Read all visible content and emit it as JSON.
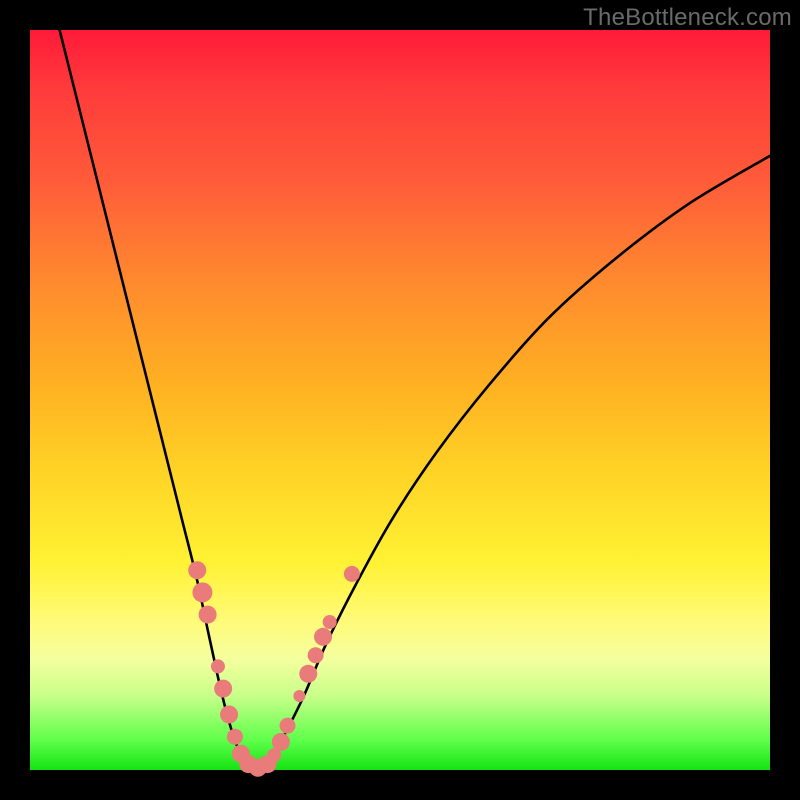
{
  "watermark": "TheBottleneck.com",
  "colors": {
    "frame": "#000000",
    "curve": "#000000",
    "dot_fill": "#e97b7b",
    "dot_stroke": "#d36a6a",
    "gradient_stops": [
      {
        "pos": 0.0,
        "hex": "#ff1a3a"
      },
      {
        "pos": 0.08,
        "hex": "#ff3b3b"
      },
      {
        "pos": 0.2,
        "hex": "#ff5a3a"
      },
      {
        "pos": 0.34,
        "hex": "#ff8a2e"
      },
      {
        "pos": 0.48,
        "hex": "#ffb122"
      },
      {
        "pos": 0.6,
        "hex": "#ffd426"
      },
      {
        "pos": 0.72,
        "hex": "#fff234"
      },
      {
        "pos": 0.8,
        "hex": "#fffb7a"
      },
      {
        "pos": 0.85,
        "hex": "#f4ff9e"
      },
      {
        "pos": 0.9,
        "hex": "#c8ff8a"
      },
      {
        "pos": 0.96,
        "hex": "#5eff4a"
      },
      {
        "pos": 1.0,
        "hex": "#15e312"
      }
    ]
  },
  "chart_data": {
    "type": "line",
    "title": "",
    "xlabel": "",
    "ylabel": "",
    "xlim": [
      0,
      100
    ],
    "ylim": [
      0,
      100
    ],
    "note": "Plot area is 740×740 px inside a 30 px black border. Curve values are approximate readings from the image: y_pct is height above the bottom edge of the gradient plot area, x_pct is distance from the left edge.",
    "series": [
      {
        "name": "bottleneck-curve-left",
        "branch": "left",
        "points": [
          {
            "x_pct": 4.0,
            "y_pct": 100.0
          },
          {
            "x_pct": 6.0,
            "y_pct": 92.0
          },
          {
            "x_pct": 8.5,
            "y_pct": 82.0
          },
          {
            "x_pct": 11.0,
            "y_pct": 72.0
          },
          {
            "x_pct": 13.5,
            "y_pct": 62.0
          },
          {
            "x_pct": 16.0,
            "y_pct": 52.0
          },
          {
            "x_pct": 18.5,
            "y_pct": 42.0
          },
          {
            "x_pct": 20.5,
            "y_pct": 34.0
          },
          {
            "x_pct": 22.5,
            "y_pct": 26.0
          },
          {
            "x_pct": 24.0,
            "y_pct": 19.0
          },
          {
            "x_pct": 25.3,
            "y_pct": 13.0
          },
          {
            "x_pct": 26.5,
            "y_pct": 8.0
          },
          {
            "x_pct": 27.7,
            "y_pct": 4.0
          },
          {
            "x_pct": 29.0,
            "y_pct": 1.2
          },
          {
            "x_pct": 30.5,
            "y_pct": 0.0
          }
        ]
      },
      {
        "name": "bottleneck-curve-right",
        "branch": "right",
        "points": [
          {
            "x_pct": 30.5,
            "y_pct": 0.0
          },
          {
            "x_pct": 32.5,
            "y_pct": 1.5
          },
          {
            "x_pct": 34.5,
            "y_pct": 5.0
          },
          {
            "x_pct": 37.0,
            "y_pct": 10.0
          },
          {
            "x_pct": 40.0,
            "y_pct": 17.0
          },
          {
            "x_pct": 44.0,
            "y_pct": 25.0
          },
          {
            "x_pct": 49.0,
            "y_pct": 34.0
          },
          {
            "x_pct": 55.0,
            "y_pct": 43.0
          },
          {
            "x_pct": 62.0,
            "y_pct": 52.0
          },
          {
            "x_pct": 70.0,
            "y_pct": 61.0
          },
          {
            "x_pct": 79.0,
            "y_pct": 69.0
          },
          {
            "x_pct": 89.0,
            "y_pct": 76.5
          },
          {
            "x_pct": 100.0,
            "y_pct": 83.0
          }
        ]
      }
    ],
    "dots": {
      "name": "highlight-dots",
      "note": "Salmon-colored circular markers near the valley. r is radius in px.",
      "points": [
        {
          "x_pct": 22.6,
          "y_pct": 27.0,
          "r": 9
        },
        {
          "x_pct": 23.3,
          "y_pct": 24.0,
          "r": 10
        },
        {
          "x_pct": 24.0,
          "y_pct": 21.0,
          "r": 9
        },
        {
          "x_pct": 25.4,
          "y_pct": 14.0,
          "r": 7
        },
        {
          "x_pct": 26.1,
          "y_pct": 11.0,
          "r": 9
        },
        {
          "x_pct": 26.9,
          "y_pct": 7.5,
          "r": 9
        },
        {
          "x_pct": 27.7,
          "y_pct": 4.5,
          "r": 8
        },
        {
          "x_pct": 28.5,
          "y_pct": 2.2,
          "r": 9
        },
        {
          "x_pct": 29.5,
          "y_pct": 0.8,
          "r": 9
        },
        {
          "x_pct": 30.8,
          "y_pct": 0.3,
          "r": 9
        },
        {
          "x_pct": 32.1,
          "y_pct": 0.8,
          "r": 9
        },
        {
          "x_pct": 33.0,
          "y_pct": 2.0,
          "r": 7
        },
        {
          "x_pct": 33.9,
          "y_pct": 3.8,
          "r": 9
        },
        {
          "x_pct": 34.8,
          "y_pct": 6.0,
          "r": 8
        },
        {
          "x_pct": 36.4,
          "y_pct": 10.0,
          "r": 6
        },
        {
          "x_pct": 37.6,
          "y_pct": 13.0,
          "r": 9
        },
        {
          "x_pct": 38.6,
          "y_pct": 15.5,
          "r": 8
        },
        {
          "x_pct": 39.6,
          "y_pct": 18.0,
          "r": 9
        },
        {
          "x_pct": 40.5,
          "y_pct": 20.0,
          "r": 7
        },
        {
          "x_pct": 43.5,
          "y_pct": 26.5,
          "r": 8
        }
      ]
    }
  }
}
